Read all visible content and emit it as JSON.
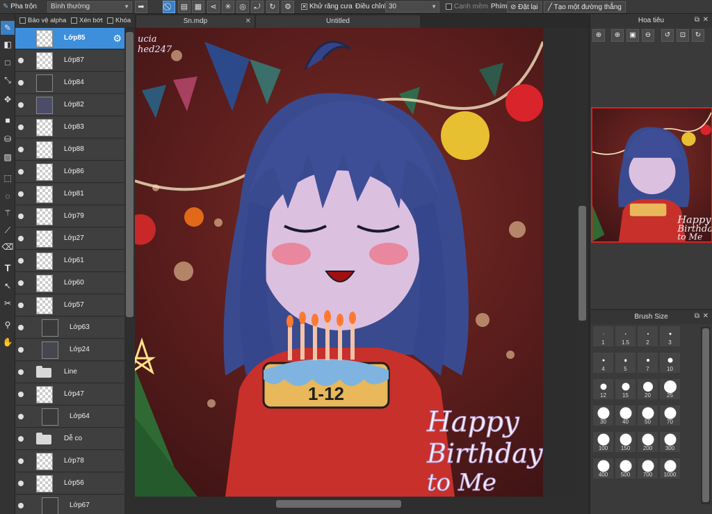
{
  "toolbar": {
    "mode": "Pha trộn",
    "blend": "Bình thường",
    "antialias_label": "Khử răng cưa",
    "adjust_label": "Điều chỉnh",
    "adjust_value": "30",
    "soft_edge_label": "Cạnh mềm",
    "key_label": "Phím",
    "reset_label": "Đặt lại",
    "line_label": "Tạo một đường thẳng"
  },
  "layer_options": {
    "protect_alpha": "Bảo vệ alpha",
    "clipping": "Xén bớt",
    "lock": "Khóa"
  },
  "tabs": [
    {
      "label": "Sn.mdp"
    },
    {
      "label": "Untitled"
    }
  ],
  "layers": [
    {
      "name": "Lớp85",
      "selected": true,
      "thumb": "checker",
      "kind": "layer"
    },
    {
      "name": "Lớp87",
      "thumb": "checker",
      "kind": "layer"
    },
    {
      "name": "Lớp84",
      "thumb": "dark",
      "kind": "layer"
    },
    {
      "name": "Lớp82",
      "thumb": "purple",
      "kind": "layer"
    },
    {
      "name": "Lớp83",
      "thumb": "checker",
      "kind": "layer"
    },
    {
      "name": "Lớp88",
      "thumb": "checker",
      "kind": "layer"
    },
    {
      "name": "Lớp86",
      "thumb": "checker",
      "kind": "layer"
    },
    {
      "name": "Lớp81",
      "thumb": "checker",
      "kind": "layer"
    },
    {
      "name": "Lớp79",
      "thumb": "checker",
      "kind": "layer"
    },
    {
      "name": "Lớp27",
      "thumb": "checker",
      "kind": "layer"
    },
    {
      "name": "Lớp61",
      "thumb": "checker",
      "kind": "layer"
    },
    {
      "name": "Lớp60",
      "thumb": "checker",
      "kind": "layer"
    },
    {
      "name": "Lớp57",
      "thumb": "checker",
      "kind": "layer"
    },
    {
      "name": "Lớp63",
      "thumb": "dark",
      "kind": "layer",
      "indent": true
    },
    {
      "name": "Lớp24",
      "thumb": "gray",
      "kind": "layer",
      "indent": true
    },
    {
      "name": "Line",
      "kind": "folder"
    },
    {
      "name": "Lớp47",
      "thumb": "checker",
      "kind": "layer"
    },
    {
      "name": "Lớp64",
      "thumb": "dark",
      "kind": "layer",
      "indent": true
    },
    {
      "name": "Dễ co",
      "kind": "folder"
    },
    {
      "name": "Lớp78",
      "thumb": "checker",
      "kind": "layer"
    },
    {
      "name": "Lớp56",
      "thumb": "checker",
      "kind": "layer"
    },
    {
      "name": "Lớp67",
      "thumb": "dark",
      "kind": "layer",
      "indent": true
    }
  ],
  "navigator": {
    "title": "Hoa tiêu"
  },
  "brush_size": {
    "title": "Brush Size",
    "sizes": [
      "1",
      "1.5",
      "2",
      "3",
      "4",
      "5",
      "7",
      "10",
      "12",
      "15",
      "20",
      "25",
      "30",
      "40",
      "50",
      "70",
      "100",
      "150",
      "200",
      "300",
      "400",
      "500",
      "700",
      "1000"
    ]
  },
  "artwork": {
    "signature": "ucia\nhed247",
    "cake_text": "1-12",
    "greeting_line1": "Happy",
    "greeting_line2": "Birthday",
    "greeting_line3": "to Me"
  },
  "colors": {
    "accent": "#3b7fc4",
    "selected_layer": "#3d8fdc",
    "hair": "#3a4a8f",
    "sweater": "#c8302c",
    "navigator_border": "#e02020"
  }
}
